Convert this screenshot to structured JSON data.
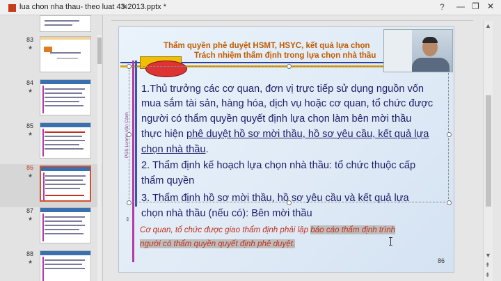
{
  "window": {
    "title": "lua chon nha thau- theo luat 43-2013.pptx *",
    "tab_close": "✕",
    "help": "?",
    "minimize": "—",
    "restore": "❐",
    "close": "✕"
  },
  "thumbnails": [
    {
      "number": "83",
      "star": "★",
      "active": false
    },
    {
      "number": "84",
      "star": "★",
      "active": false
    },
    {
      "number": "85",
      "star": "★",
      "active": false
    },
    {
      "number": "86",
      "star": "★",
      "active": true
    },
    {
      "number": "87",
      "star": "★",
      "active": false
    },
    {
      "number": "88",
      "star": "★",
      "active": false
    }
  ],
  "slide": {
    "heading_line1": "Thẩm quyền phê duyệt HSMT, HSYC, kết quả lựa chọn",
    "heading_line2": "Trách nhiệm thẩm định trong lựa chọn nhà thầu",
    "vertical_label": "PGS Lương Văn Cảnh",
    "paragraphs": [
      {
        "line": "1.Thủ trưởng các cơ quan, đơn vị trực tiếp sử dụng nguồn vốn"
      },
      {
        "line": "mua sắm tài sản, hàng hóa, dịch vụ hoặc cơ quan, tổ chức được"
      },
      {
        "line": "người có thẩm quyền quyết định lựa chọn làm bên mời thầu"
      },
      {
        "line": "thực hiện ",
        "underlined": "phê duyệt hồ sơ mời thầu, hồ sơ yêu cầu, kết quả lựa"
      },
      {
        "line": "",
        "underlined": "chọn nhà thầu",
        "after": "."
      },
      {
        "line": "2. Thẩm định kế hoạch lựa chọn nhà thầu: tổ chức thuộc cấp"
      },
      {
        "line": "thẩm quyền"
      },
      {
        "line": "3. Thẩm định hồ sơ mời thầu, hồ sơ yêu cầu và kết quả lựa"
      },
      {
        "line": "chọn nhà thầu (nếu có): Bên mời thầu"
      }
    ],
    "note_line1": "Cơ quan, tổ chức được giao thẩm định phải lập ",
    "note_line1_highlight": "báo cáo thẩm định trình",
    "note_line2_highlight": "người có thẩm quyền quyết định phê duyệt.",
    "page_number": "86"
  },
  "scroll": {
    "up": "▲",
    "down": "▼",
    "page_up": "⇞",
    "page_down": "⇟",
    "position": 0.58
  },
  "icons": {
    "text-anchor-arrows": "⇕"
  }
}
